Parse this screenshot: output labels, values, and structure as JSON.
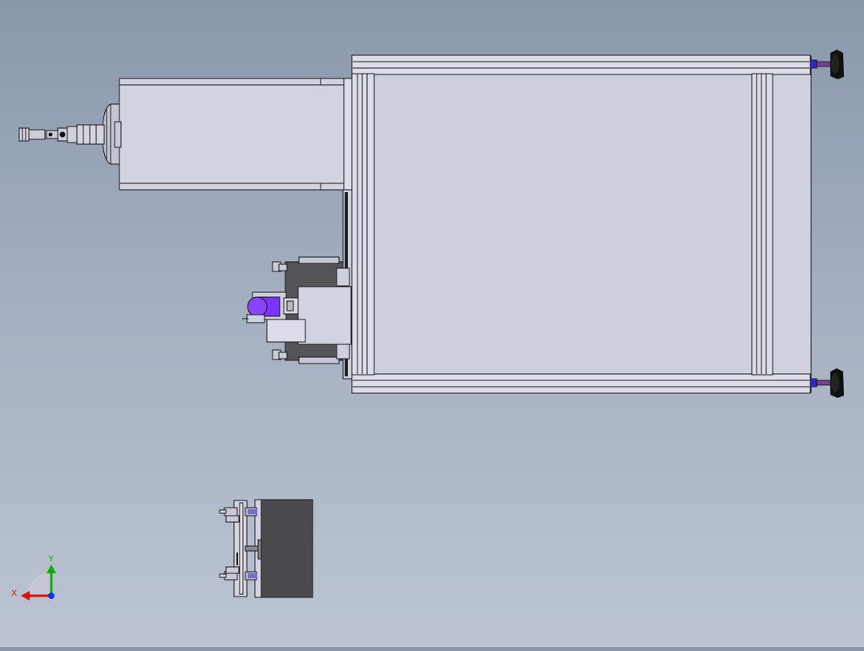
{
  "viewport": {
    "background_top": "#8a98ac",
    "background_bottom": "#bcc4d2"
  },
  "colors": {
    "part_fill": "#d2d3e0",
    "part_fill_light": "#dcdde8",
    "outline": "#1a1a1a",
    "dark_block": "#555559",
    "cylinder_purple": "#7a33ff",
    "foot_black": "#111111",
    "bolt_purple": "#7b3f8c",
    "axis_x": "#dd1111",
    "axis_y": "#11aa11",
    "axis_z": "#1133dd"
  },
  "icons": {
    "triad": "coordinate-triad-icon"
  },
  "triad": {
    "x_label": "X",
    "y_label": "Y"
  }
}
